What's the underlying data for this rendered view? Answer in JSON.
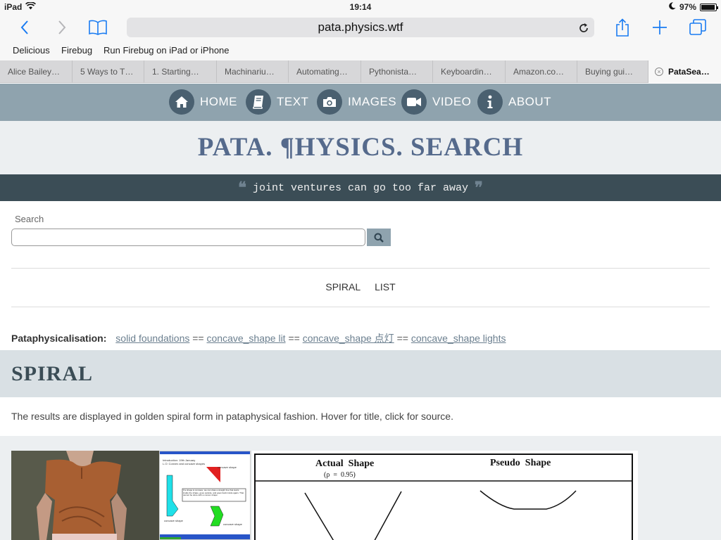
{
  "status": {
    "device": "iPad",
    "time": "19:14",
    "battery": "97%",
    "battery_level": 0.97
  },
  "browser": {
    "url": "pata.physics.wtf",
    "favorites": [
      "Delicious",
      "Firebug",
      "Run Firebug on iPad or iPhone"
    ],
    "tabs": [
      "Alice Bailey…",
      "5 Ways to T…",
      "1. Starting…",
      "Machinariu…",
      "Automating…",
      "Pythonista…",
      "Keyboardin…",
      "Amazon.co…",
      "Buying gui…",
      "PataSea…"
    ],
    "active_tab": 9
  },
  "nav": {
    "home": "HOME",
    "text": "TEXT",
    "images": "IMAGES",
    "video": "VIDEO",
    "about": "ABOUT"
  },
  "site": {
    "title": "PATA. ¶HYSICS. SEARCH",
    "quote": "joint ventures can go too far away"
  },
  "search": {
    "label": "Search",
    "value": ""
  },
  "views": {
    "spiral": "SPIRAL",
    "list": "LIST"
  },
  "pataphysicalisation": {
    "label": "Pataphysicalisation:",
    "separator": "==",
    "terms": [
      "solid foundations",
      "concave_shape lit",
      "concave_shape 点灯",
      "concave_shape lights"
    ]
  },
  "section": {
    "title": "SPIRAL",
    "description": "The results are displayed in golden spiral form in pataphysical fashion. Hover for title, click for source."
  },
  "images": {
    "diagram": {
      "header_lines": [
        "Introduction: 19th January",
        "L.O: Convex and concave shapes"
      ],
      "label_top": "concave shape",
      "note": "If a shape is concave, we can draw a straight line that starts inside the shape, goes outside, and goes back inside again. That cannot be done with a convex shape.",
      "label_left": "concave shape",
      "label_right": "concave shape"
    },
    "plot": {
      "actual": "Actual  Shape",
      "rho": "(ρ  =  0.95)",
      "pseudo": "Pseudo  Shape"
    }
  },
  "colors": {
    "nav_bg": "#8fa3ae",
    "nav_circle": "#4a6070",
    "title": "#556a8c",
    "quote_bg": "#3b4d56",
    "link": "#6b7f8f"
  }
}
